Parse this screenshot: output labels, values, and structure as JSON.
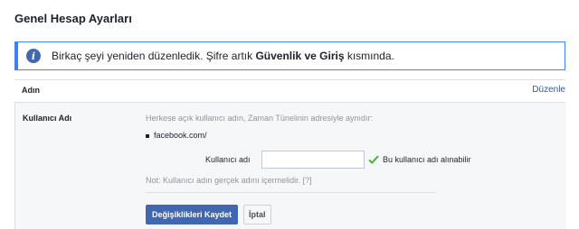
{
  "page": {
    "title": "Genel Hesap Ayarları"
  },
  "notice": {
    "icon": "info-icon",
    "text_before": "Birkaç şeyi yeniden düzenledik. Şifre artık ",
    "text_bold": "Güvenlik ve Giriş",
    "text_after": " kısmında."
  },
  "name_row": {
    "label": "Adın",
    "edit_label": "Düzenle"
  },
  "username_section": {
    "label": "Kullanıcı Adı",
    "description": "Herkese açık kullanıcı adın, Zaman Tünelinin adresiyle aynıdır:",
    "url": "facebook.com/",
    "field_label": "Kullanıcı adı",
    "field_value": "",
    "availability": "Bu kullanıcı adı alınabilir",
    "note_prefix": "Not: ",
    "note_text": "Kullanıcı adın gerçek adını içermelidir.",
    "help": "[?]",
    "save_label": "Değişiklikleri Kaydet",
    "cancel_label": "İptal"
  },
  "colors": {
    "accent": "#4267b2",
    "notice_border": "#4080ff",
    "link": "#365899",
    "check": "#42b72a"
  }
}
